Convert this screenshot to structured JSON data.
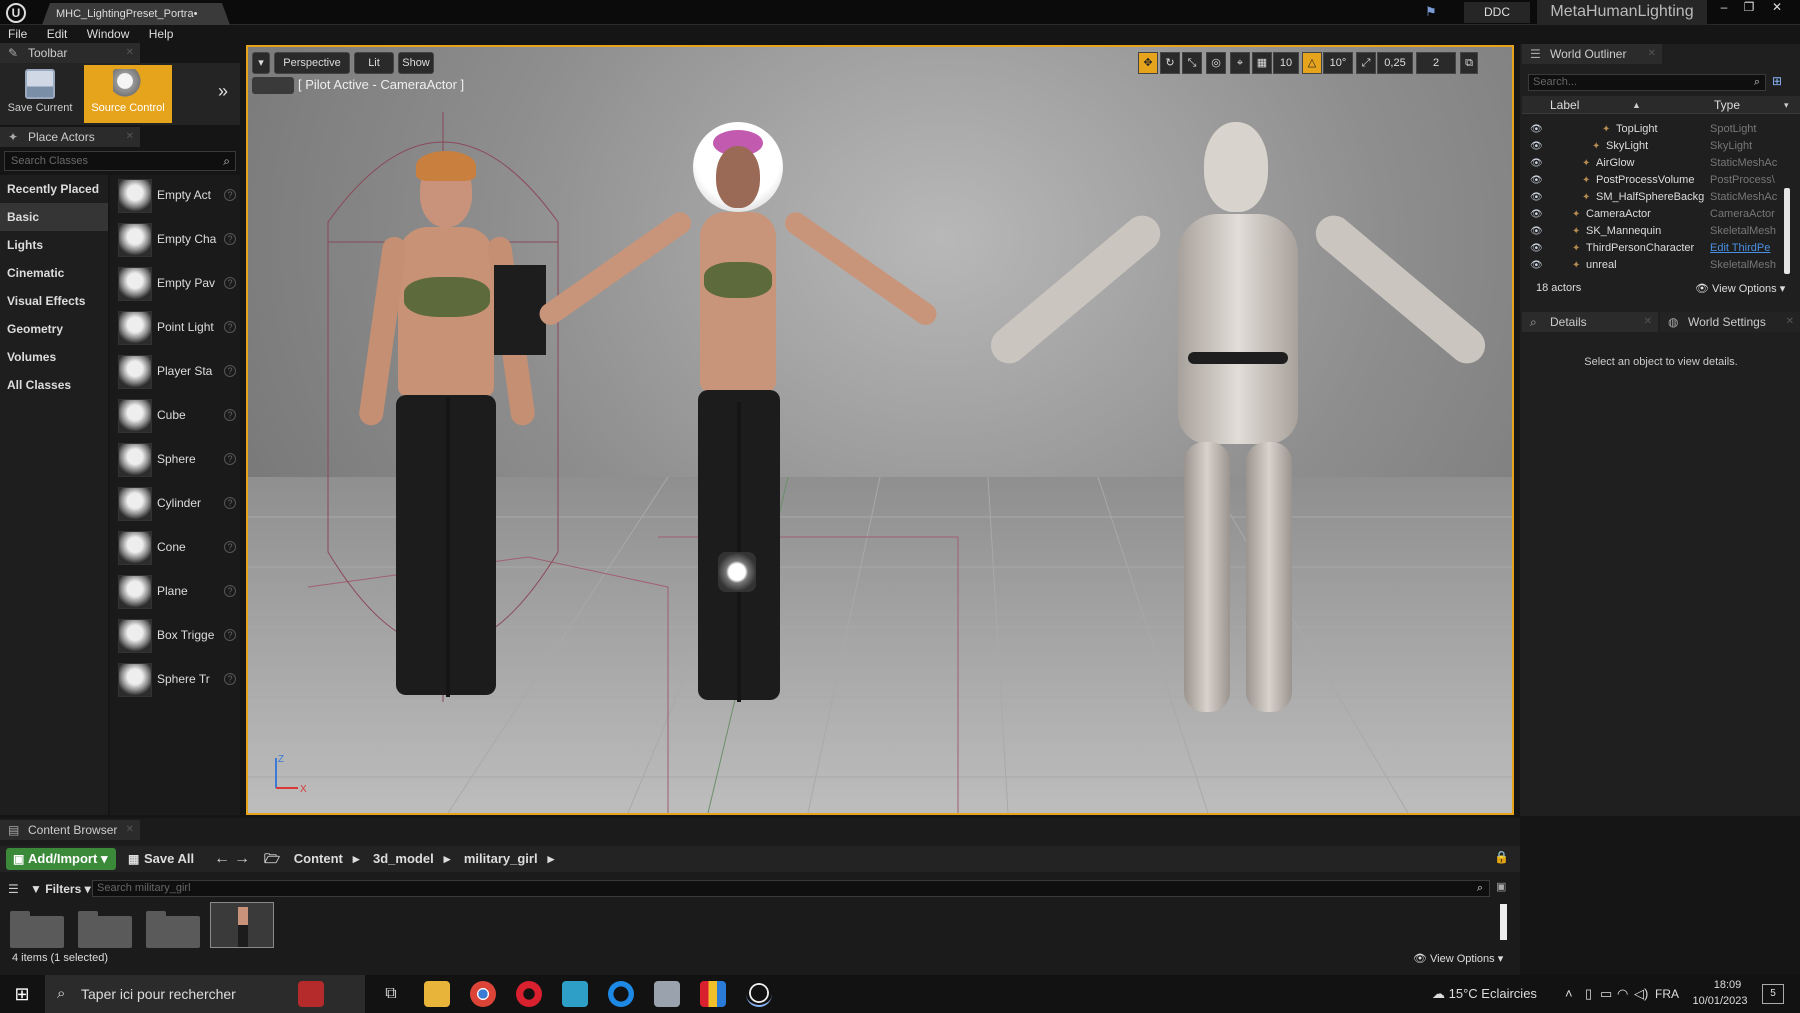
{
  "titlebar": {
    "doc_tab": "MHC_LightingPreset_Portra•",
    "ddc_label": "DDC",
    "project_name": "MetaHumanLighting",
    "controls": {
      "minimize": "–",
      "restore": "❐",
      "close": "✕"
    }
  },
  "menu": [
    "File",
    "Edit",
    "Window",
    "Help"
  ],
  "toolbar": {
    "tab_label": "Toolbar",
    "save_current": "Save Current",
    "source_control": "Source Control"
  },
  "place_actors": {
    "tab_label": "Place Actors",
    "search_placeholder": "Search Classes",
    "categories": [
      "Recently Placed",
      "Basic",
      "Lights",
      "Cinematic",
      "Visual Effects",
      "Geometry",
      "Volumes",
      "All Classes"
    ],
    "active_category": "Basic",
    "classes": [
      "Empty Act",
      "Empty Cha",
      "Empty Pav",
      "Point Light",
      "Player Sta",
      "Cube",
      "Sphere",
      "Cylinder",
      "Cone",
      "Plane",
      "Box Trigge",
      "Sphere Tr"
    ]
  },
  "viewport": {
    "perspective_label": "Perspective",
    "lit_label": "Lit",
    "show_label": "Show",
    "pilot_label": "[ Pilot Active - CameraActor ]",
    "snap_grid_value": "10",
    "snap_rotation_value": "10°",
    "snap_scale_value": "0,25",
    "camera_speed_value": "2",
    "axis_z": "Z",
    "axis_x": "X"
  },
  "outliner": {
    "tab_label": "World Outliner",
    "search_placeholder": "Search...",
    "col_label": "Label",
    "col_type": "Type",
    "rows": [
      {
        "label": "TopLight",
        "type": "SpotLight",
        "indent": 3
      },
      {
        "label": "SkyLight",
        "type": "SkyLight",
        "indent": 2
      },
      {
        "label": "AirGlow",
        "type": "StaticMeshAc",
        "indent": 1
      },
      {
        "label": "PostProcessVolume",
        "type": "PostProcess\\",
        "indent": 1
      },
      {
        "label": "SM_HalfSphereBackg",
        "type": "StaticMeshAc",
        "indent": 1
      },
      {
        "label": "CameraActor",
        "type": "CameraActor",
        "indent": 0
      },
      {
        "label": "SK_Mannequin",
        "type": "SkeletalMesh",
        "indent": 0
      },
      {
        "label": "ThirdPersonCharacter",
        "type": "Edit ThirdPe",
        "indent": 0,
        "link": true
      },
      {
        "label": "unreal",
        "type": "SkeletalMesh",
        "indent": 0
      }
    ],
    "actor_count": "18 actors",
    "view_options": "View Options"
  },
  "details": {
    "tab_label": "Details",
    "world_settings_label": "World Settings",
    "empty_message": "Select an object to view details."
  },
  "content_browser": {
    "tab_label": "Content Browser",
    "add_import": "Add/Import",
    "save_all": "Save All",
    "breadcrumbs": [
      "Content",
      "3d_model",
      "military_girl"
    ],
    "filters_label": "Filters",
    "search_placeholder": "Search military_girl",
    "items_count": "4 items (1 selected)",
    "view_options": "View Options"
  },
  "taskbar": {
    "search_placeholder": "Taper ici pour rechercher",
    "weather_temp": "15°C",
    "weather_text": "Eclaircies",
    "language": "FRA",
    "time": "18:09",
    "date": "10/01/2023",
    "notifications": "5"
  },
  "colors": {
    "accent": "#e6a41d",
    "link": "#4a90e2",
    "add_button": "#3a8a3a"
  }
}
